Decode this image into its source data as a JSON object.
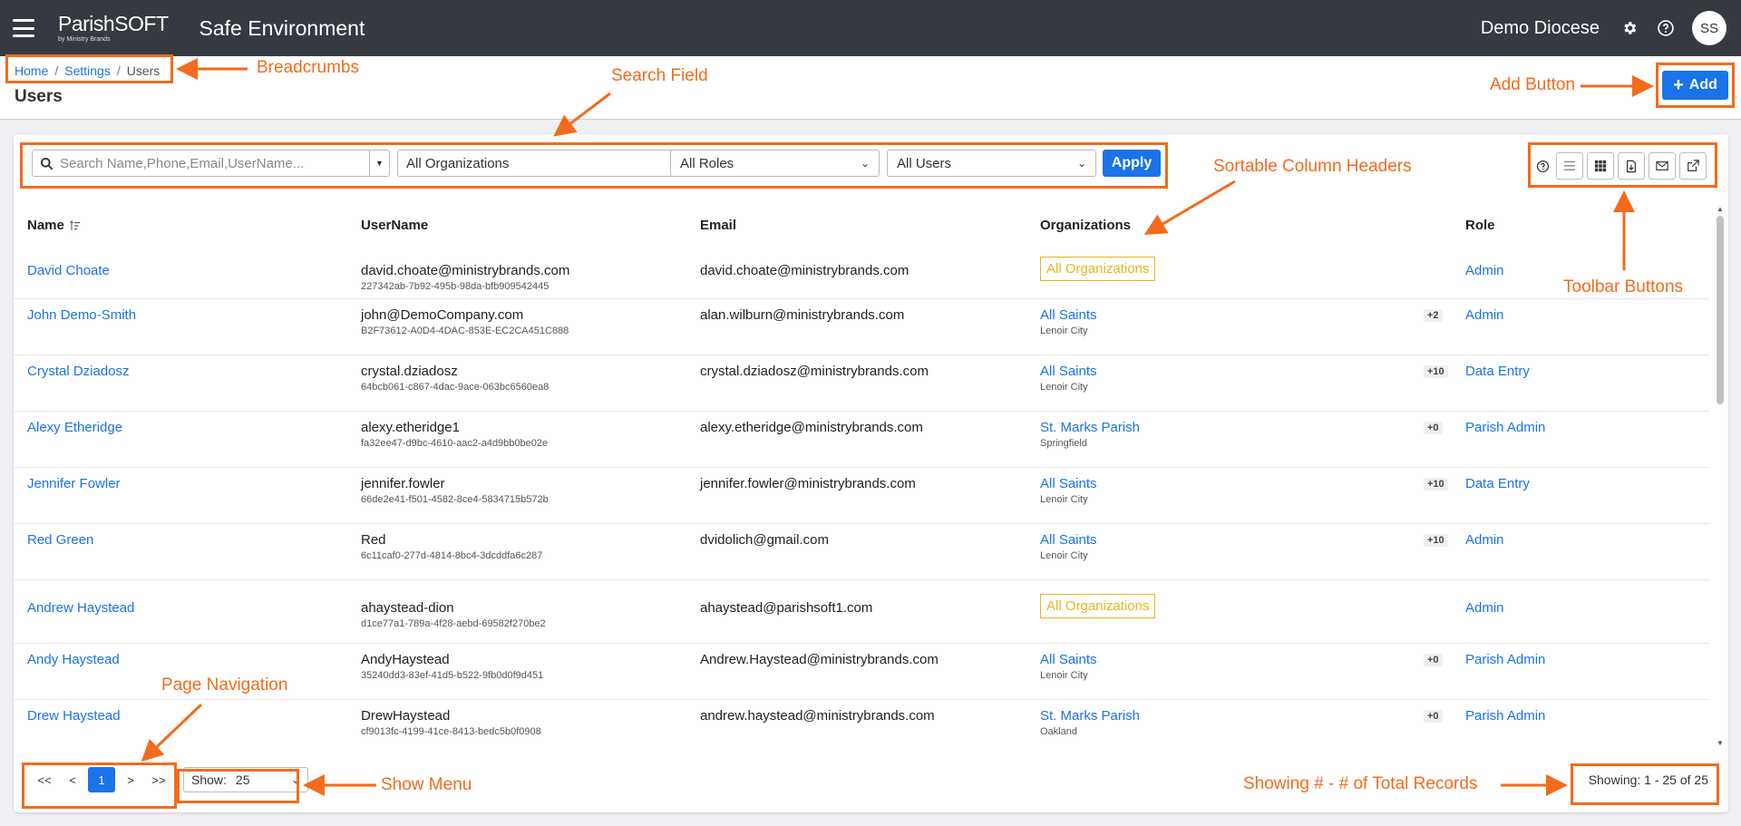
{
  "topbar": {
    "logo_main": "ParishSOFT",
    "logo_sub": "by Ministry Brands",
    "app_title": "Safe Environment",
    "diocese": "Demo Diocese",
    "avatar_initials": "SS"
  },
  "breadcrumb": {
    "home": "Home",
    "settings": "Settings",
    "current": "Users"
  },
  "page_title": "Users",
  "add_button": "Add",
  "filters": {
    "search_placeholder": "Search Name,Phone,Email,UserName...",
    "organizations": "All Organizations",
    "roles": "All Roles",
    "users": "All Users",
    "apply": "Apply"
  },
  "columns": {
    "name": "Name",
    "username": "UserName",
    "email": "Email",
    "organizations": "Organizations",
    "role": "Role"
  },
  "rows": [
    {
      "name": "David Choate",
      "username": "david.choate@ministrybrands.com",
      "uid": "227342ab-7b92-495b-98da-bfb909542445",
      "email": "david.choate@ministrybrands.com",
      "org": "All Organizations",
      "org_sub": "",
      "badge": "",
      "role": "Admin"
    },
    {
      "name": "John Demo-Smith",
      "username": "john@DemoCompany.com",
      "uid": "B2F73612-A0D4-4DAC-853E-EC2CA451C888",
      "email": "alan.wilburn@ministrybrands.com",
      "org": "All Saints",
      "org_sub": "Lenoir City",
      "badge": "+2",
      "role": "Admin"
    },
    {
      "name": "Crystal Dziadosz",
      "username": "crystal.dziadosz",
      "uid": "64bcb061-c867-4dac-9ace-063bc6560ea8",
      "email": "crystal.dziadosz@ministrybrands.com",
      "org": "All Saints",
      "org_sub": "Lenoir City",
      "badge": "+10",
      "role": "Data Entry"
    },
    {
      "name": "Alexy Etheridge",
      "username": "alexy.etheridge1",
      "uid": "fa32ee47-d9bc-4610-aac2-a4d9bb0be02e",
      "email": "alexy.etheridge@ministrybrands.com",
      "org": "St. Marks Parish",
      "org_sub": "Springfield",
      "badge": "+0",
      "role": "Parish Admin"
    },
    {
      "name": "Jennifer Fowler",
      "username": "jennifer.fowler",
      "uid": "66de2e41-f501-4582-8ce4-5834715b572b",
      "email": "jennifer.fowler@ministrybrands.com",
      "org": "All Saints",
      "org_sub": "Lenoir City",
      "badge": "+10",
      "role": "Data Entry"
    },
    {
      "name": "Red Green",
      "username": "Red",
      "uid": "6c11caf0-277d-4814-8bc4-3dcddfa6c287",
      "email": "dvidolich@gmail.com",
      "org": "All Saints",
      "org_sub": "Lenoir City",
      "badge": "+10",
      "role": "Admin"
    },
    {
      "name": "Andrew Haystead",
      "username": "ahaystead-dion",
      "uid": "d1ce77a1-789a-4f28-aebd-69582f270be2",
      "email": "ahaystead@parishsoft1.com",
      "org": "All Organizations",
      "org_sub": "",
      "badge": "",
      "role": "Admin"
    },
    {
      "name": "Andy Haystead",
      "username": "AndyHaystead",
      "uid": "35240dd3-83ef-41d5-b522-9fb0d0f9d451",
      "email": "Andrew.Haystead@ministrybrands.com",
      "org": "All Saints",
      "org_sub": "Lenoir City",
      "badge": "+0",
      "role": "Parish Admin"
    },
    {
      "name": "Drew Haystead",
      "username": "DrewHaystead",
      "uid": "cf9013fc-4199-41ce-8413-bedc5b0f0908",
      "email": "andrew.haystead@ministrybrands.com",
      "org": "St. Marks Parish",
      "org_sub": "Oakland",
      "badge": "+0",
      "role": "Parish Admin"
    }
  ],
  "pager": {
    "first": "<<",
    "prev": "<",
    "current": "1",
    "next": ">",
    "last": ">>"
  },
  "show": {
    "label": "Show:",
    "value": "25"
  },
  "showing": "Showing: 1 - 25 of 25",
  "annotations": {
    "breadcrumbs": "Breadcrumbs",
    "search_field": "Search Field",
    "add_button": "Add Button",
    "sortable_headers": "Sortable Column Headers",
    "toolbar_buttons": "Toolbar Buttons",
    "page_navigation": "Page Navigation",
    "show_menu": "Show Menu",
    "showing_records": "Showing # - # of Total Records"
  },
  "colors": {
    "topbar": "#343a40",
    "primary": "#1a73e8",
    "annotation": "#f26b1d",
    "org_badge": "#e6b422"
  }
}
